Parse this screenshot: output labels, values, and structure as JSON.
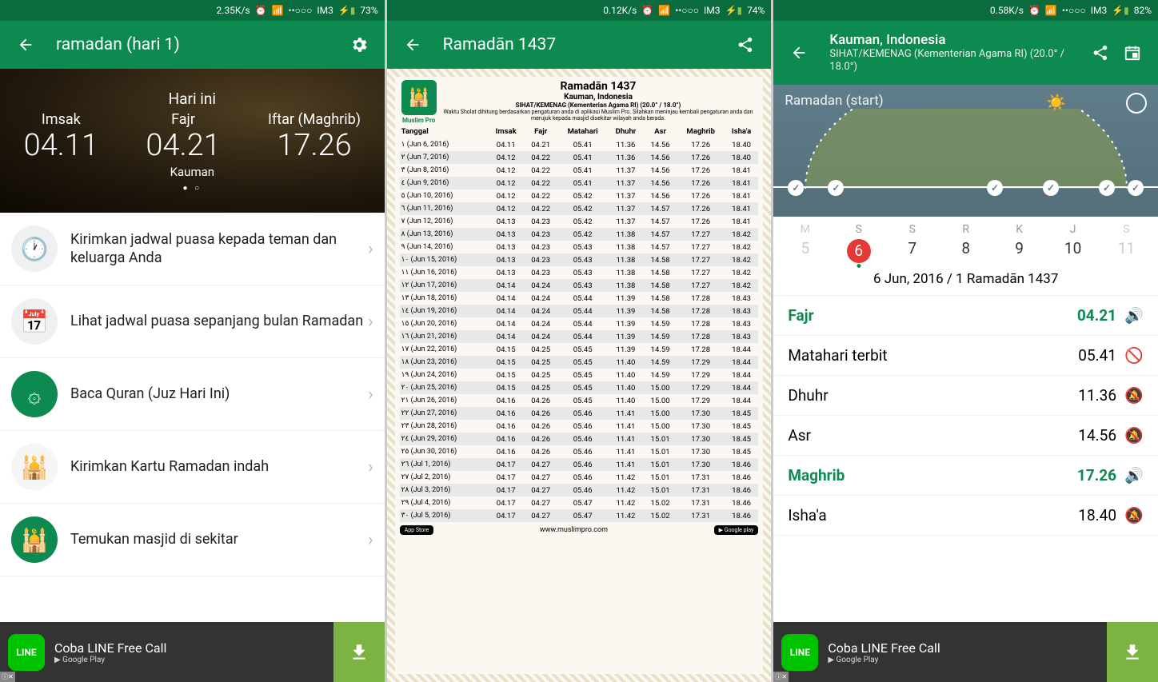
{
  "status": [
    {
      "speed": "2.35K/s",
      "carrier": "IM3",
      "battery": "73%"
    },
    {
      "speed": "0.12K/s",
      "carrier": "IM3",
      "battery": "74%"
    },
    {
      "speed": "0.58K/s",
      "carrier": "IM3",
      "battery": "82%"
    }
  ],
  "s1": {
    "title": "ramadan (hari 1)",
    "hero_top": "Hari ini",
    "location": "Kauman",
    "cols": [
      {
        "label": "Imsak",
        "value": "04.11"
      },
      {
        "label": "Fajr",
        "value": "04.21"
      },
      {
        "label": "Iftar (Maghrib)",
        "value": "17.26"
      }
    ],
    "items": [
      "Kirimkan jadwal puasa kepada teman dan keluarga Anda",
      "Lihat jadwal puasa sepanjang bulan Ramadan",
      "Baca Quran (Juz Hari Ini)",
      "Kirimkan Kartu Ramadan indah",
      "Temukan masjid di sekitar"
    ],
    "icons": [
      "clock-icon",
      "calendar-icon",
      "quran-icon",
      "card-icon",
      "mosque-icon"
    ],
    "icon_bg": [
      "#f0f0f0",
      "#f0f0f0",
      "#0d8a4f",
      "#f5f5f5",
      "#0d8a4f"
    ]
  },
  "ad": {
    "text": "Coba LINE Free Call",
    "store": "Google Play",
    "brand": "LINE"
  },
  "s2": {
    "title": "Ramadān 1437",
    "logo_text": "Muslim Pro",
    "header": {
      "h1": "Ramadān 1437",
      "h2": "Kauman, Indonesia",
      "h3": "SIHAT/KEMENAG (Kementerian Agama RI) (20.0° / 18.0°)",
      "h4": "Waktu Sholat dihitung berdasarkan pengaturan anda di aplikasi Muslim Pro. Silahkan meninjau kembali pengaturan anda dan merujuk kepada masjid disekitar wilayah anda berada."
    },
    "cols": [
      "Tanggal",
      "Imsak",
      "Fajr",
      "Matahari",
      "Dhuhr",
      "Asr",
      "Maghrib",
      "Isha'a"
    ],
    "rows": [
      [
        "١ (Jun 6, 2016)",
        "04.11",
        "04.21",
        "05.41",
        "11.36",
        "14.56",
        "17.26",
        "18.40"
      ],
      [
        "٢ (Jun 7, 2016)",
        "04.12",
        "04.22",
        "05.41",
        "11.36",
        "14.56",
        "17.26",
        "18.40"
      ],
      [
        "٣ (Jun 8, 2016)",
        "04.12",
        "04.22",
        "05.41",
        "11.37",
        "14.56",
        "17.26",
        "18.41"
      ],
      [
        "٤ (Jun 9, 2016)",
        "04.12",
        "04.22",
        "05.41",
        "11.37",
        "14.56",
        "17.26",
        "18.41"
      ],
      [
        "٥ (Jun 10, 2016)",
        "04.12",
        "04.22",
        "05.42",
        "11.37",
        "14.56",
        "17.26",
        "18.41"
      ],
      [
        "٦ (Jun 11, 2016)",
        "04.12",
        "04.22",
        "05.42",
        "11.37",
        "14.57",
        "17.26",
        "18.41"
      ],
      [
        "٧ (Jun 12, 2016)",
        "04.13",
        "04.23",
        "05.42",
        "11.37",
        "14.57",
        "17.26",
        "18.41"
      ],
      [
        "٨ (Jun 13, 2016)",
        "04.13",
        "04.23",
        "05.42",
        "11.38",
        "14.57",
        "17.27",
        "18.42"
      ],
      [
        "٩ (Jun 14, 2016)",
        "04.13",
        "04.23",
        "05.43",
        "11.38",
        "14.57",
        "17.27",
        "18.42"
      ],
      [
        "١٠ (Jun 15, 2016)",
        "04.13",
        "04.23",
        "05.43",
        "11.38",
        "14.58",
        "17.27",
        "18.42"
      ],
      [
        "١١ (Jun 16, 2016)",
        "04.13",
        "04.23",
        "05.43",
        "11.38",
        "14.58",
        "17.27",
        "18.42"
      ],
      [
        "١٢ (Jun 17, 2016)",
        "04.14",
        "04.24",
        "05.43",
        "11.38",
        "14.58",
        "17.27",
        "18.42"
      ],
      [
        "١٣ (Jun 18, 2016)",
        "04.14",
        "04.24",
        "05.44",
        "11.39",
        "14.58",
        "17.28",
        "18.43"
      ],
      [
        "١٤ (Jun 19, 2016)",
        "04.14",
        "04.24",
        "05.44",
        "11.39",
        "14.58",
        "17.28",
        "18.43"
      ],
      [
        "١٥ (Jun 20, 2016)",
        "04.14",
        "04.24",
        "05.44",
        "11.39",
        "14.59",
        "17.28",
        "18.43"
      ],
      [
        "١٦ (Jun 21, 2016)",
        "04.14",
        "04.24",
        "05.44",
        "11.39",
        "14.59",
        "17.28",
        "18.43"
      ],
      [
        "١٧ (Jun 22, 2016)",
        "04.15",
        "04.25",
        "05.45",
        "11.39",
        "14.59",
        "17.28",
        "18.44"
      ],
      [
        "١٨ (Jun 23, 2016)",
        "04.15",
        "04.25",
        "05.45",
        "11.40",
        "14.59",
        "17.29",
        "18.44"
      ],
      [
        "١٩ (Jun 24, 2016)",
        "04.15",
        "04.25",
        "05.45",
        "11.40",
        "14.59",
        "17.29",
        "18.44"
      ],
      [
        "٢٠ (Jun 25, 2016)",
        "04.15",
        "04.25",
        "05.45",
        "11.40",
        "15.00",
        "17.29",
        "18.44"
      ],
      [
        "٢١ (Jun 26, 2016)",
        "04.16",
        "04.26",
        "05.45",
        "11.40",
        "15.00",
        "17.29",
        "18.44"
      ],
      [
        "٢٢ (Jun 27, 2016)",
        "04.16",
        "04.26",
        "05.46",
        "11.41",
        "15.00",
        "17.30",
        "18.45"
      ],
      [
        "٢٣ (Jun 28, 2016)",
        "04.16",
        "04.26",
        "05.46",
        "11.41",
        "15.00",
        "17.30",
        "18.45"
      ],
      [
        "٢٤ (Jun 29, 2016)",
        "04.16",
        "04.26",
        "05.46",
        "11.41",
        "15.01",
        "17.30",
        "18.45"
      ],
      [
        "٢٥ (Jun 30, 2016)",
        "04.16",
        "04.26",
        "05.46",
        "11.41",
        "15.01",
        "17.30",
        "18.45"
      ],
      [
        "٢٦ (Jul 1, 2016)",
        "04.17",
        "04.27",
        "05.46",
        "11.41",
        "15.01",
        "17.30",
        "18.46"
      ],
      [
        "٢٧ (Jul 2, 2016)",
        "04.17",
        "04.27",
        "05.46",
        "11.42",
        "15.01",
        "17.31",
        "18.46"
      ],
      [
        "٢٨ (Jul 3, 2016)",
        "04.17",
        "04.27",
        "05.46",
        "11.42",
        "15.01",
        "17.31",
        "18.46"
      ],
      [
        "٢٩ (Jul 4, 2016)",
        "04.17",
        "04.27",
        "05.47",
        "11.42",
        "15.02",
        "17.31",
        "18.46"
      ],
      [
        "٣٠ (Jul 5, 2016)",
        "04.17",
        "04.27",
        "05.47",
        "11.42",
        "15.02",
        "17.31",
        "18.46"
      ]
    ],
    "footer_url": "www.muslimpro.com",
    "appstore": "App Store",
    "googleplay": "Google play"
  },
  "s3": {
    "title": "Kauman, Indonesia",
    "sub": "SIHAT/KEMENAG (Kementerian Agama RI) (20.0° / 18.0°)",
    "arc_label": "Ramadan (start)",
    "week_days": [
      "M",
      "S",
      "S",
      "R",
      "K",
      "J",
      "S"
    ],
    "week_nums": [
      "5",
      "6",
      "7",
      "8",
      "9",
      "10",
      "11"
    ],
    "today_idx": 1,
    "date_line": "6 Jun, 2016 / 1 Ramadān 1437",
    "prayers": [
      {
        "name": "Fajr",
        "time": "04.21",
        "active": true,
        "notif": "sound"
      },
      {
        "name": "Matahari terbit",
        "time": "05.41",
        "active": false,
        "notif": "none"
      },
      {
        "name": "Dhuhr",
        "time": "11.36",
        "active": false,
        "notif": "mute"
      },
      {
        "name": "Asr",
        "time": "14.56",
        "active": false,
        "notif": "mute"
      },
      {
        "name": "Maghrib",
        "time": "17.26",
        "active": true,
        "notif": "sound"
      },
      {
        "name": "Isha'a",
        "time": "18.40",
        "active": false,
        "notif": "mute"
      }
    ]
  }
}
